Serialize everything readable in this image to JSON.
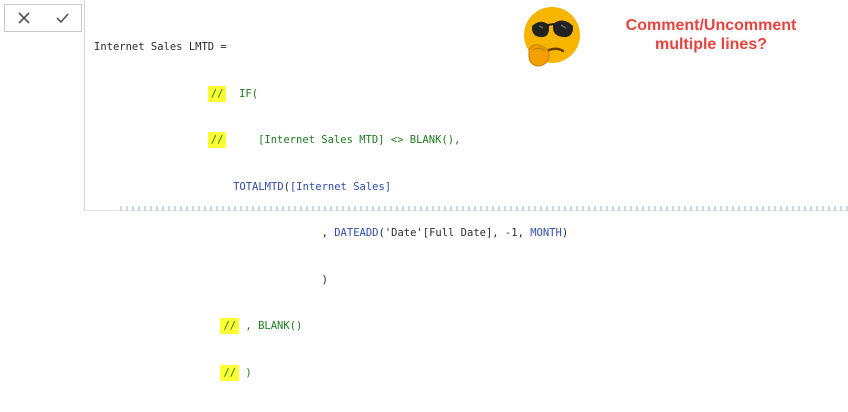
{
  "toolbar": {
    "cancel_icon": "close-icon",
    "commit_icon": "check-icon"
  },
  "formula": {
    "l1": "Internet Sales LMTD =",
    "l2_comment": "//",
    "l2_kw": "IF(",
    "l3_comment": "//",
    "l3_code": "[Internet Sales MTD] <> BLANK(),",
    "l4_fn": "TOTALMTD",
    "l4_paren": "(",
    "l4_ref": "[Internet Sales]",
    "l5_prefix": ", ",
    "l5_fn": "DATEADD",
    "l5_mid": "('Date'[Full Date], -1, ",
    "l5_kw": "MONTH",
    "l5_end": ")",
    "l6": ")",
    "l7_comment": "//",
    "l7_code": ", BLANK()",
    "l8_comment": "//",
    "l8_code": ")"
  },
  "callout": {
    "line1": "Comment/Uncomment",
    "line2": "multiple lines?"
  },
  "colors": {
    "highlight": "#ffff33",
    "comment": "#1f7a1f",
    "function": "#2e4da7",
    "callout": "#e4433e"
  }
}
